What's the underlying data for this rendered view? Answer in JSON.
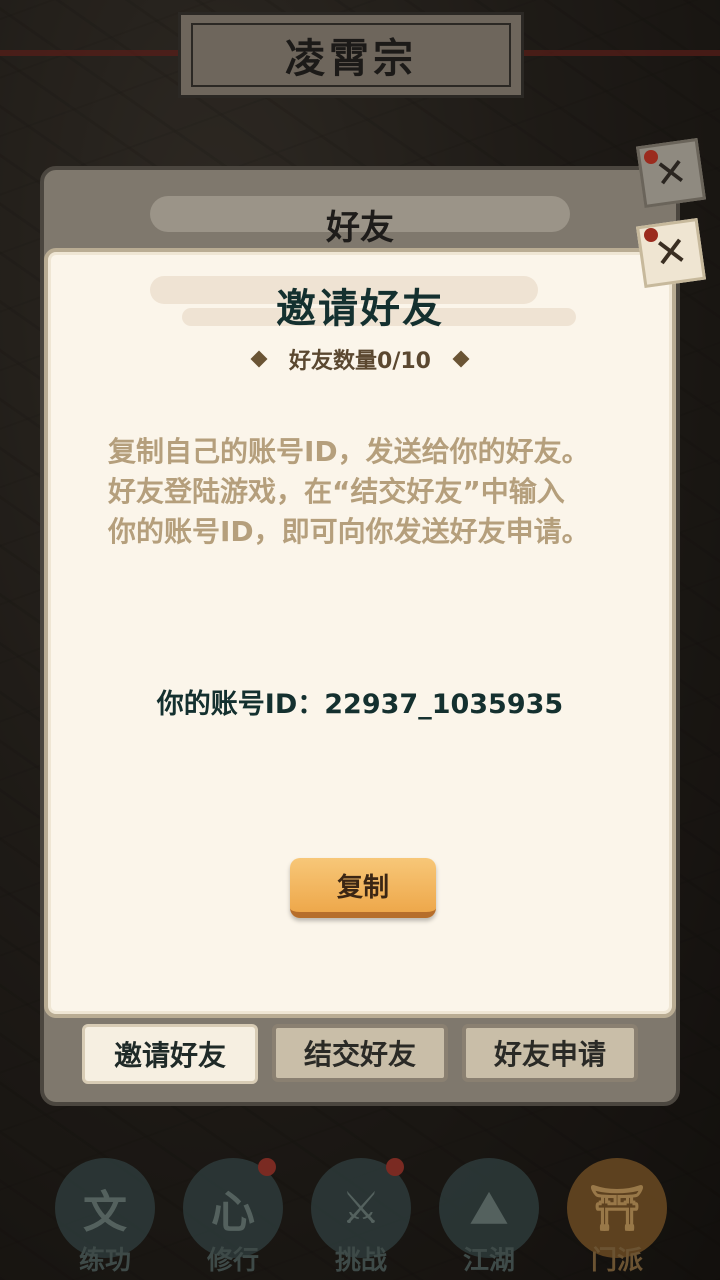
{
  "header": {
    "sect_name": "凌霄宗"
  },
  "back_panel": {
    "title": "好友",
    "close_glyph": "✕"
  },
  "dialog": {
    "title": "邀请好友",
    "friend_count": "好友数量0/10",
    "description": [
      "复制自己的账号ID，发送给你的好友。",
      "好友登陆游戏，在“结交好友”中输入",
      "你的账号ID，即可向你发送好友申请。"
    ],
    "account_label": "你的账号ID：22937_1035935",
    "copy_button": "复制",
    "close_glyph": "✕"
  },
  "tabs": [
    {
      "label": "邀请好友",
      "active": true
    },
    {
      "label": "结交好友",
      "active": false
    },
    {
      "label": "好友申请",
      "active": false
    }
  ],
  "bottom_nav": [
    {
      "label": "练功",
      "icon": "practice-icon",
      "glyph": "文",
      "badge": false,
      "active": false
    },
    {
      "label": "修行",
      "icon": "heart-icon",
      "glyph": "心",
      "badge": true,
      "active": false
    },
    {
      "label": "挑战",
      "icon": "crossed-swords-icon",
      "glyph": "⚔",
      "badge": true,
      "active": false
    },
    {
      "label": "江湖",
      "icon": "mountain-icon",
      "glyph": "⛰",
      "badge": false,
      "active": false
    },
    {
      "label": "门派",
      "icon": "gate-icon",
      "glyph": "⛩",
      "badge": false,
      "active": true
    }
  ]
}
